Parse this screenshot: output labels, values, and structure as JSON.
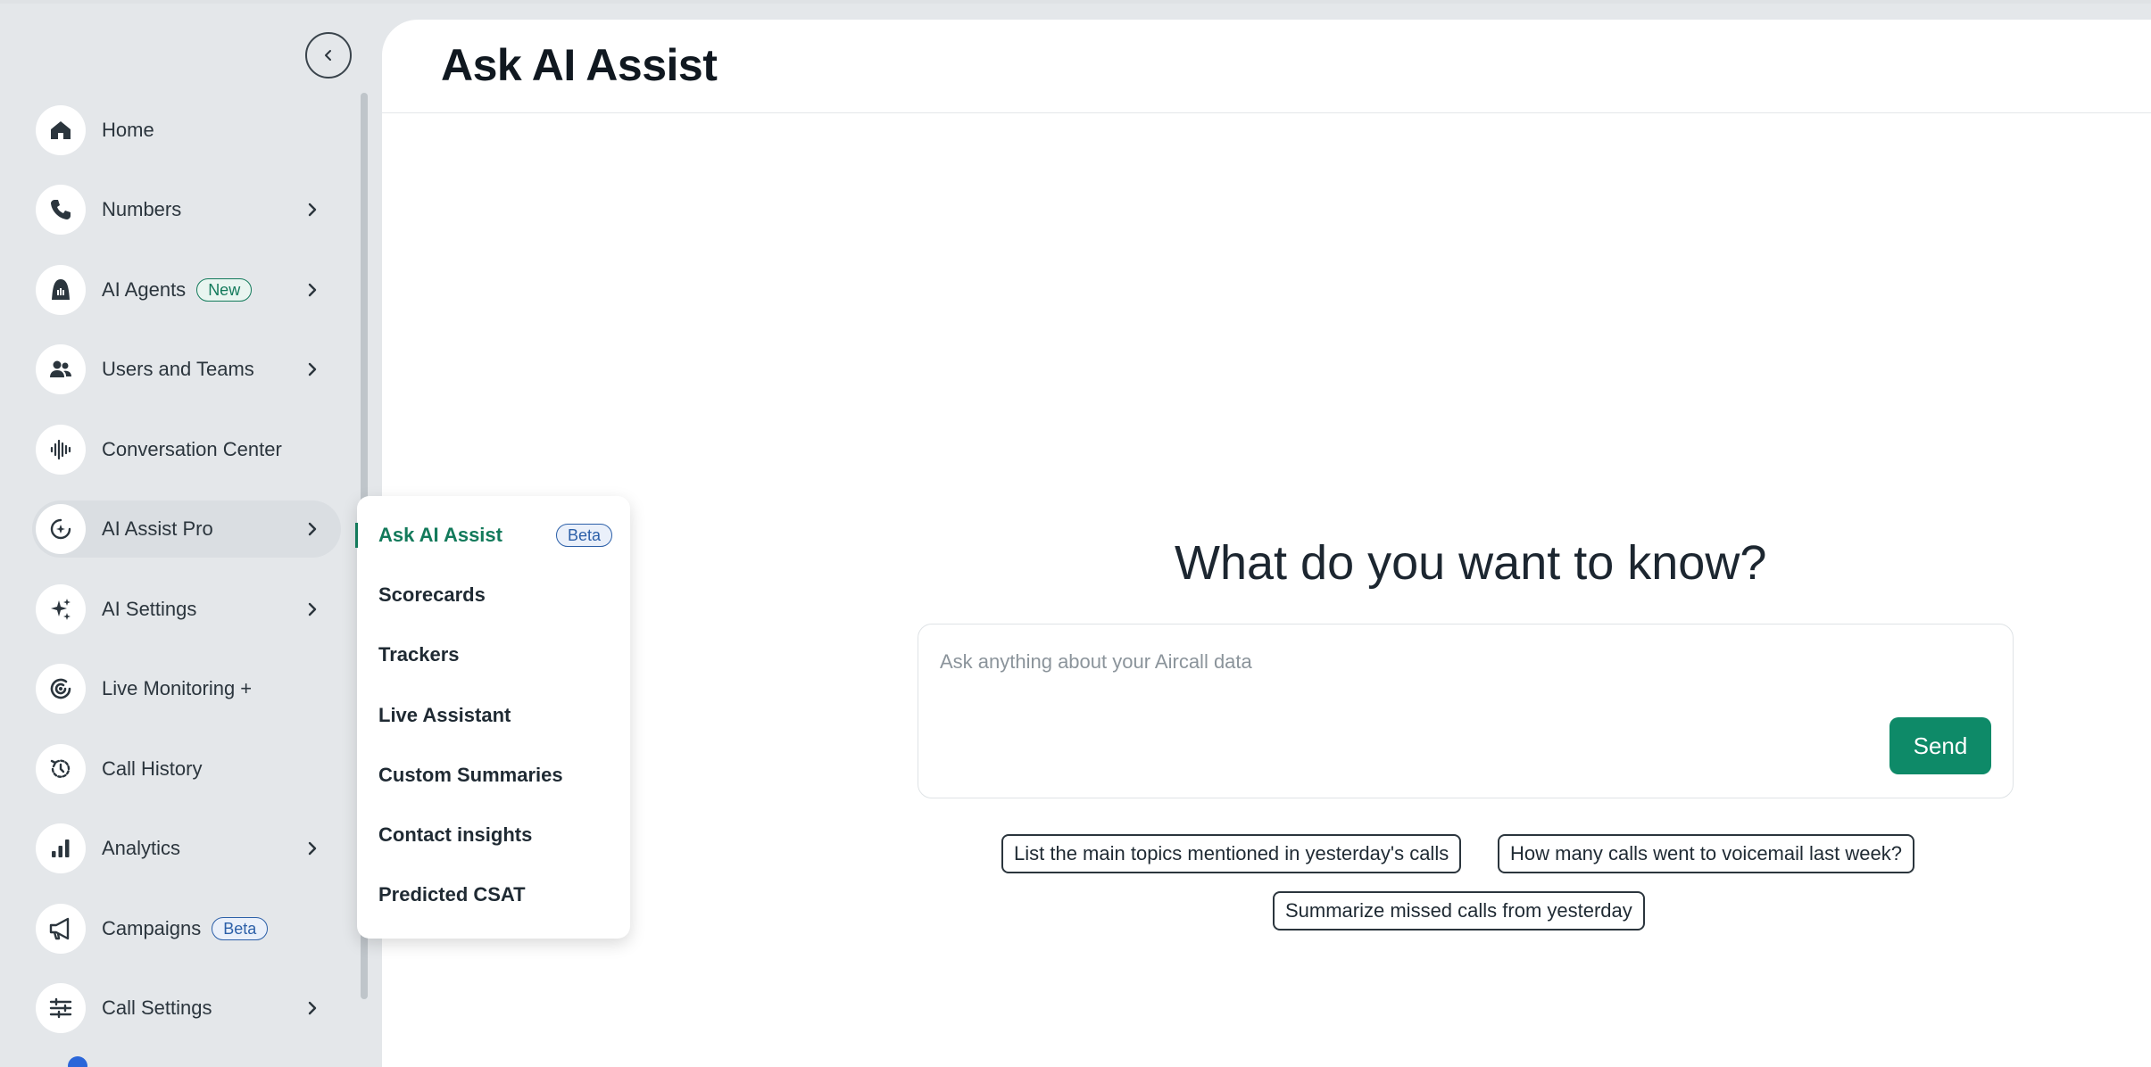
{
  "page": {
    "title": "Ask AI Assist"
  },
  "sidebar": {
    "items": [
      {
        "label": "Home",
        "icon": "home-icon",
        "has_chevron": false
      },
      {
        "label": "Numbers",
        "icon": "phone-icon",
        "has_chevron": true
      },
      {
        "label": "AI Agents",
        "icon": "ai-agent-icon",
        "has_chevron": true,
        "badge": "New"
      },
      {
        "label": "Users and Teams",
        "icon": "users-icon",
        "has_chevron": true
      },
      {
        "label": "Conversation Center",
        "icon": "waveform-icon",
        "has_chevron": false
      },
      {
        "label": "AI Assist Pro",
        "icon": "ai-assist-icon",
        "has_chevron": true
      },
      {
        "label": "AI Settings",
        "icon": "sparkles-icon",
        "has_chevron": true
      },
      {
        "label": "Live Monitoring +",
        "icon": "live-monitoring-icon",
        "has_chevron": false
      },
      {
        "label": "Call History",
        "icon": "history-icon",
        "has_chevron": false
      },
      {
        "label": "Analytics",
        "icon": "bar-chart-icon",
        "has_chevron": true
      },
      {
        "label": "Campaigns",
        "icon": "megaphone-icon",
        "has_chevron": false,
        "badge": "Beta"
      },
      {
        "label": "Call Settings",
        "icon": "sliders-icon",
        "has_chevron": true
      }
    ]
  },
  "submenu": {
    "items": [
      {
        "label": "Ask AI Assist",
        "badge": "Beta",
        "active": true
      },
      {
        "label": "Scorecards"
      },
      {
        "label": "Trackers"
      },
      {
        "label": "Live Assistant"
      },
      {
        "label": "Custom Summaries"
      },
      {
        "label": "Contact insights"
      },
      {
        "label": "Predicted CSAT"
      }
    ]
  },
  "main": {
    "prompt_title": "What do you want to know?",
    "input_placeholder": "Ask anything about your Aircall data",
    "send_label": "Send",
    "suggestions": [
      "List the main topics mentioned in yesterday's calls",
      "How many calls went to voicemail last week?",
      "Summarize missed calls from yesterday"
    ]
  },
  "colors": {
    "accent": "#0e8a68",
    "sidebar_bg": "#e4e7ea",
    "beta_badge": "#2b5fa8"
  }
}
